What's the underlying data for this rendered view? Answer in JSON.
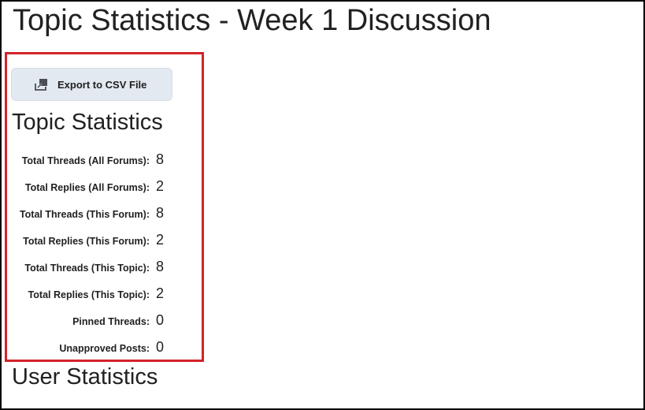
{
  "page": {
    "title": "Topic Statistics - Week 1 Discussion"
  },
  "export_button": {
    "label": "Export to CSV File",
    "icon": "export-icon"
  },
  "topic_statistics": {
    "heading": "Topic Statistics",
    "rows": [
      {
        "label": "Total Threads (All Forums):",
        "value": "8"
      },
      {
        "label": "Total Replies (All Forums):",
        "value": "2"
      },
      {
        "label": "Total Threads (This Forum):",
        "value": "8"
      },
      {
        "label": "Total Replies (This Forum):",
        "value": "2"
      },
      {
        "label": "Total Threads (This Topic):",
        "value": "8"
      },
      {
        "label": "Total Replies (This Topic):",
        "value": "2"
      },
      {
        "label": "Pinned Threads:",
        "value": "0"
      },
      {
        "label": "Unapproved Posts:",
        "value": "0"
      }
    ]
  },
  "user_statistics": {
    "heading": "User Statistics"
  },
  "colors": {
    "highlight_border": "#d3232a",
    "button_bg": "#e3e9f1",
    "text": "#202122"
  }
}
